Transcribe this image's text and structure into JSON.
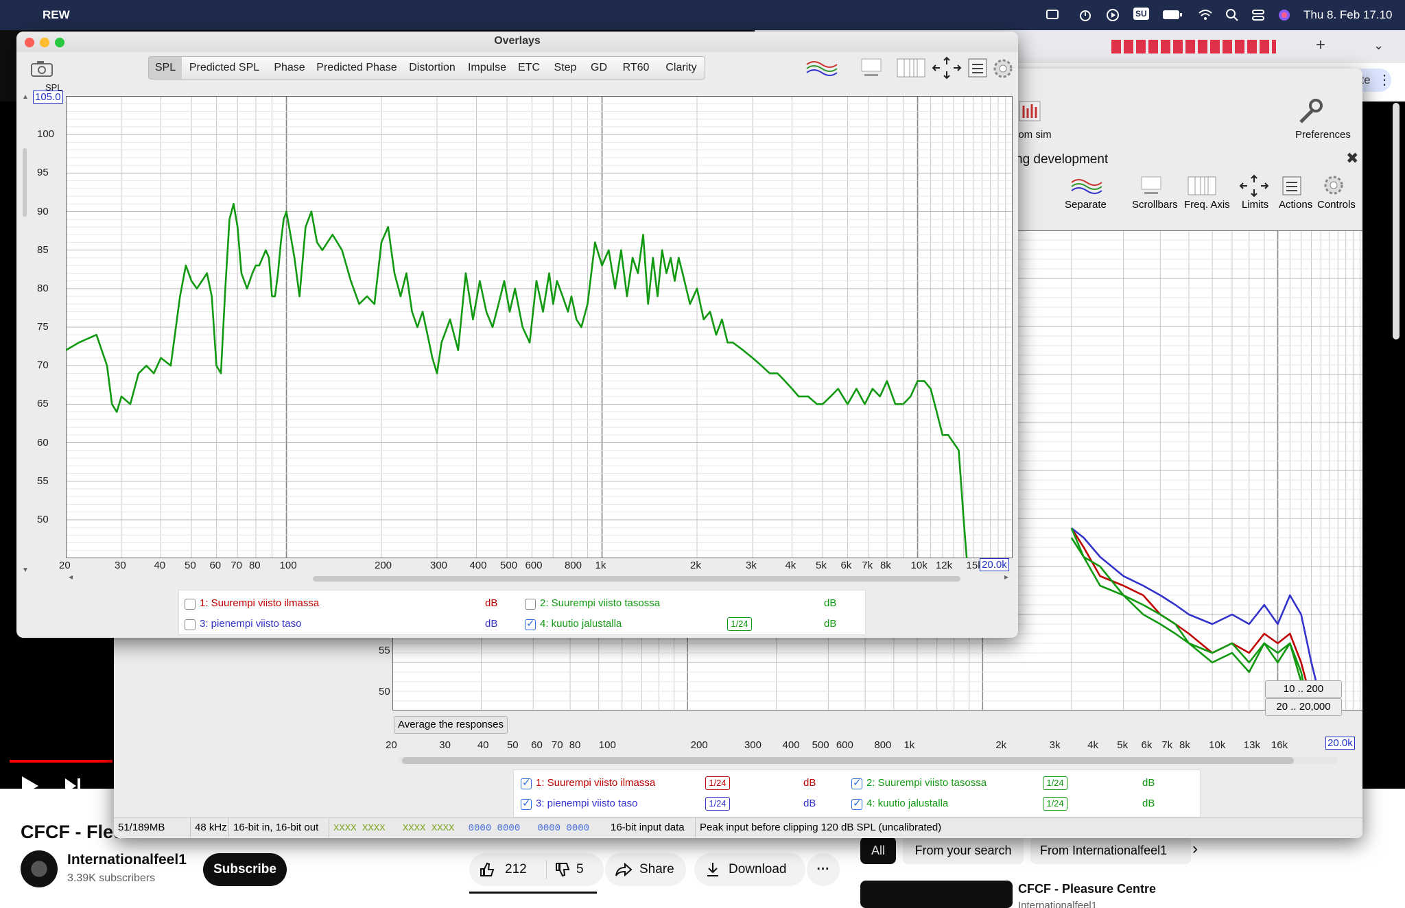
{
  "menubar": {
    "app_name": "REW",
    "status_item_su": "SU",
    "datetime": "Thu 8. Feb  17.10"
  },
  "youtube": {
    "video_title": "CFCF - Fleu",
    "channel_name": "Internationalfeel1",
    "subscribers": "3.39K subscribers",
    "subscribe_label": "Subscribe",
    "likes": "212",
    "dislikes": "5",
    "share_label": "Share",
    "download_label": "Download",
    "more_label": "···",
    "filters": [
      "All",
      "From your search",
      "From Internationalfeel1"
    ],
    "rec_title": "CFCF - Pleasure Centre",
    "rec_channel": "Internationalfeel1",
    "browser_new_tab": "+",
    "browser_update": "ate"
  },
  "rew_main": {
    "toolbar": {
      "room_sim_label": "oom sim",
      "preferences_label": "Preferences"
    },
    "graph_title": "ng development",
    "graph_controls": [
      "Separate",
      "Scrollbars",
      "Freq. Axis",
      "Limits",
      "Actions",
      "Controls"
    ],
    "y_ticks": [
      "55",
      "50"
    ],
    "average_button": "Average the responses",
    "range_buttons": [
      "10 .. 200",
      "20 .. 20,000"
    ],
    "x_ticks": [
      "20",
      "30",
      "40",
      "50",
      "60",
      "70",
      "80",
      "100",
      "200",
      "300",
      "400",
      "500",
      "600",
      "800",
      "1k",
      "2k",
      "3k",
      "4k",
      "5k",
      "6k",
      "7k",
      "8k",
      "10k",
      "13k",
      "16k"
    ],
    "x_max": "20.0k",
    "legend": [
      {
        "label": "1: Suurempi viisto ilmassa",
        "checked": true,
        "smoothing": "1/24",
        "unit": "dB",
        "color": "#c00000"
      },
      {
        "label": "2: Suurempi viisto tasossa",
        "checked": true,
        "smoothing": "1/24",
        "unit": "dB",
        "color": "#119911"
      },
      {
        "label": "3: pienempi viisto taso",
        "checked": true,
        "smoothing": "1/24",
        "unit": "dB",
        "color": "#3333cc"
      },
      {
        "label": "4: kuutio jalustalla",
        "checked": true,
        "smoothing": "1/24",
        "unit": "dB",
        "color": "#119911"
      }
    ],
    "status": {
      "memory": "51/189MB",
      "sample_rate": "48 kHz",
      "bits": "16-bit in, 16-bit out",
      "meter_green": "XXXX XXXX   XXXX XXXX",
      "meter_blue": "0000 0000   0000 0000",
      "input_data": "16-bit input data",
      "peak": "Peak input before clipping 120 dB SPL (uncalibrated)"
    },
    "chart_data": {
      "type": "line",
      "x_scale": "log",
      "xlim": [
        20,
        20000
      ],
      "series": [
        {
          "name": "1: Suurempi viisto ilmassa",
          "color": "#c00000",
          "x": [
            2000,
            2200,
            2500,
            3000,
            3500,
            4000,
            4500,
            5000,
            6000,
            7000,
            8000,
            9000,
            10000,
            11000,
            12000,
            13000,
            14000,
            15000
          ],
          "y": [
            64,
            62,
            59,
            58,
            57,
            55,
            54,
            53,
            51,
            52,
            51,
            53,
            52,
            53,
            50,
            46,
            41,
            37
          ]
        },
        {
          "name": "2: Suurempi viisto tasossa",
          "color": "#119911",
          "x": [
            2000,
            2200,
            2500,
            3000,
            3500,
            4000,
            4500,
            5000,
            6000,
            7000,
            8000,
            9000,
            10000,
            11000,
            12000,
            13000,
            14000,
            15000
          ],
          "y": [
            63,
            61,
            60,
            57,
            56,
            55,
            54,
            52,
            51,
            52,
            50,
            52,
            51,
            52,
            49,
            44,
            38,
            33
          ]
        },
        {
          "name": "3: pienempi viisto taso",
          "color": "#3333cc",
          "x": [
            2000,
            2200,
            2500,
            3000,
            3500,
            4000,
            4500,
            5000,
            6000,
            7000,
            8000,
            9000,
            10000,
            11000,
            12000,
            13000,
            14000,
            15000
          ],
          "y": [
            64,
            63,
            61,
            59,
            58,
            57,
            56,
            55,
            54,
            55,
            54,
            56,
            54,
            57,
            55,
            50,
            46,
            41
          ]
        },
        {
          "name": "4: kuutio jalustalla",
          "color": "#119911",
          "x": [
            2000,
            2200,
            2500,
            3000,
            3500,
            4000,
            4500,
            5000,
            6000,
            7000,
            8000,
            9000,
            10000,
            11000,
            12000,
            13000,
            14000,
            15000
          ],
          "y": [
            64,
            61,
            58,
            57,
            55,
            54,
            53,
            52,
            50,
            51,
            49,
            52,
            50,
            52,
            48,
            43,
            37,
            31
          ]
        }
      ]
    }
  },
  "overlays": {
    "title": "Overlays",
    "tabs": [
      "SPL",
      "Predicted SPL",
      "Phase",
      "Predicted Phase",
      "Distortion",
      "Impulse",
      "ETC",
      "Step",
      "GD",
      "RT60",
      "Clarity"
    ],
    "selected_tab": "SPL",
    "y_axis_label": "SPL",
    "y_max": "105.0",
    "y_ticks": [
      "100",
      "95",
      "90",
      "85",
      "80",
      "75",
      "70",
      "65",
      "60",
      "55",
      "50"
    ],
    "x_ticks": [
      "20",
      "30",
      "40",
      "50",
      "60",
      "70",
      "80",
      "100",
      "200",
      "300",
      "400",
      "500",
      "600",
      "800",
      "1k",
      "2k",
      "3k",
      "4k",
      "5k",
      "6k",
      "7k",
      "8k",
      "10k",
      "12k",
      "15k"
    ],
    "x_max": "20.0k",
    "legend": [
      {
        "label": "1: Suurempi viisto ilmassa",
        "checked": false,
        "smoothing": "",
        "unit": "dB",
        "color": "#c00000"
      },
      {
        "label": "2: Suurempi viisto tasossa",
        "checked": false,
        "smoothing": "",
        "unit": "dB",
        "color": "#119911"
      },
      {
        "label": "3: pienempi viisto taso",
        "checked": false,
        "smoothing": "",
        "unit": "dB",
        "color": "#3333cc"
      },
      {
        "label": "4: kuutio jalustalla",
        "checked": true,
        "smoothing": "1/24",
        "unit": "dB",
        "color": "#119911"
      }
    ],
    "chart_data": {
      "type": "line",
      "x_scale": "log",
      "xlim": [
        20,
        20000
      ],
      "ylim": [
        45,
        105
      ],
      "ylabel": "SPL",
      "grid": true,
      "series": [
        {
          "name": "4: kuutio jalustalla",
          "color": "#119911",
          "x": [
            20,
            22,
            25,
            27,
            28,
            29,
            30,
            32,
            34,
            36,
            38,
            40,
            43,
            46,
            48,
            50,
            52,
            54,
            56,
            58,
            60,
            62,
            64,
            66,
            68,
            70,
            72,
            75,
            78,
            80,
            82,
            84,
            86,
            88,
            90,
            92,
            94,
            96,
            98,
            100,
            103,
            106,
            110,
            115,
            120,
            125,
            130,
            140,
            150,
            160,
            170,
            180,
            190,
            200,
            210,
            220,
            230,
            240,
            250,
            260,
            270,
            280,
            290,
            300,
            310,
            330,
            350,
            370,
            390,
            410,
            430,
            450,
            470,
            490,
            510,
            530,
            560,
            590,
            620,
            650,
            680,
            700,
            720,
            750,
            780,
            800,
            830,
            860,
            900,
            950,
            1000,
            1050,
            1100,
            1150,
            1200,
            1250,
            1300,
            1350,
            1400,
            1450,
            1500,
            1550,
            1600,
            1650,
            1700,
            1750,
            1800,
            1900,
            2000,
            2100,
            2200,
            2300,
            2400,
            2500,
            2600,
            2800,
            3000,
            3200,
            3400,
            3600,
            3800,
            4000,
            4200,
            4500,
            4800,
            5000,
            5300,
            5600,
            6000,
            6400,
            6800,
            7200,
            7600,
            8000,
            8500,
            9000,
            9500,
            10000,
            10500,
            11000,
            11500,
            12000,
            12500,
            13000,
            13500,
            14000,
            14500,
            15000
          ],
          "y": [
            72,
            73,
            74,
            70,
            65,
            64,
            66,
            65,
            69,
            70,
            69,
            71,
            70,
            79,
            83,
            81,
            80,
            81,
            82,
            79,
            70,
            69,
            80,
            89,
            91,
            88,
            82,
            80,
            82,
            83,
            83,
            84,
            85,
            84,
            79,
            79,
            82,
            86,
            89,
            90,
            87,
            84,
            79,
            88,
            90,
            86,
            85,
            87,
            85,
            81,
            78,
            79,
            78,
            86,
            88,
            82,
            79,
            82,
            77,
            75,
            77,
            74,
            71,
            69,
            73,
            76,
            72,
            82,
            76,
            81,
            77,
            75,
            78,
            81,
            77,
            80,
            75,
            73,
            81,
            77,
            82,
            78,
            81,
            79,
            77,
            79,
            76,
            75,
            78,
            86,
            83,
            85,
            80,
            85,
            79,
            84,
            82,
            87,
            78,
            84,
            79,
            85,
            82,
            84,
            81,
            84,
            82,
            78,
            80,
            76,
            77,
            74,
            76,
            73,
            73,
            72,
            71,
            70,
            69,
            69,
            68,
            67,
            66,
            66,
            65,
            65,
            66,
            67,
            65,
            67,
            65,
            67,
            66,
            68,
            65,
            65,
            66,
            68,
            68,
            67,
            64,
            61,
            61,
            60,
            59,
            50,
            42,
            32
          ]
        }
      ]
    }
  }
}
